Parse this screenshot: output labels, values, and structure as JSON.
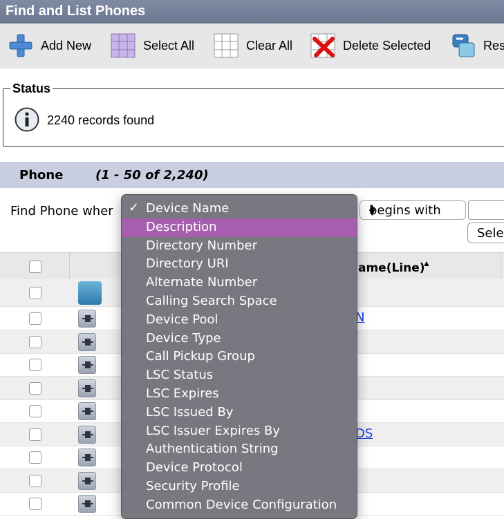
{
  "window": {
    "title": "Find and List Phones"
  },
  "toolbar": {
    "add_new": "Add New",
    "select_all": "Select All",
    "clear_all": "Clear All",
    "delete_selected": "Delete Selected",
    "reset_partial": "Res"
  },
  "status": {
    "legend": "Status",
    "message": "2240 records found"
  },
  "phone_section": {
    "title": "Phone",
    "range": "(1 - 50 of 2,240)"
  },
  "find": {
    "label": "Find Phone wher",
    "operator": "begins with",
    "search_value": "",
    "select_button_partial": "Sele"
  },
  "table": {
    "sort_column_partial": "ame(Line)",
    "sort_indicator": "▲"
  },
  "rows": [
    {
      "link": ""
    },
    {
      "link": "N"
    },
    {
      "link": ""
    },
    {
      "link": ""
    },
    {
      "link": ""
    },
    {
      "link": ""
    },
    {
      "link": "DS"
    },
    {
      "link": ""
    },
    {
      "link": ""
    },
    {
      "link": ""
    }
  ],
  "dropdown": {
    "selected": "Device Name",
    "highlighted": "Description",
    "options": [
      "Device Name",
      "Description",
      "Directory Number",
      "Directory URI",
      "Alternate Number",
      "Calling Search Space",
      "Device Pool",
      "Device Type",
      "Call Pickup Group",
      "LSC Status",
      "LSC Expires",
      "LSC Issued By",
      "LSC Issuer Expires By",
      "Authentication String",
      "Device Protocol",
      "Security Profile",
      "Common Device Configuration"
    ]
  },
  "colors": {
    "header_bg": "#6b7690",
    "section_bg": "#c9cfe0",
    "highlight": "#a55fae",
    "link": "#1a3edc"
  },
  "icons": [
    "add-new-icon",
    "select-all-icon",
    "clear-all-icon",
    "delete-selected-icon",
    "reset-icon",
    "info-icon",
    "device-icon",
    "sort-ascending-icon",
    "checkmark-icon"
  ]
}
